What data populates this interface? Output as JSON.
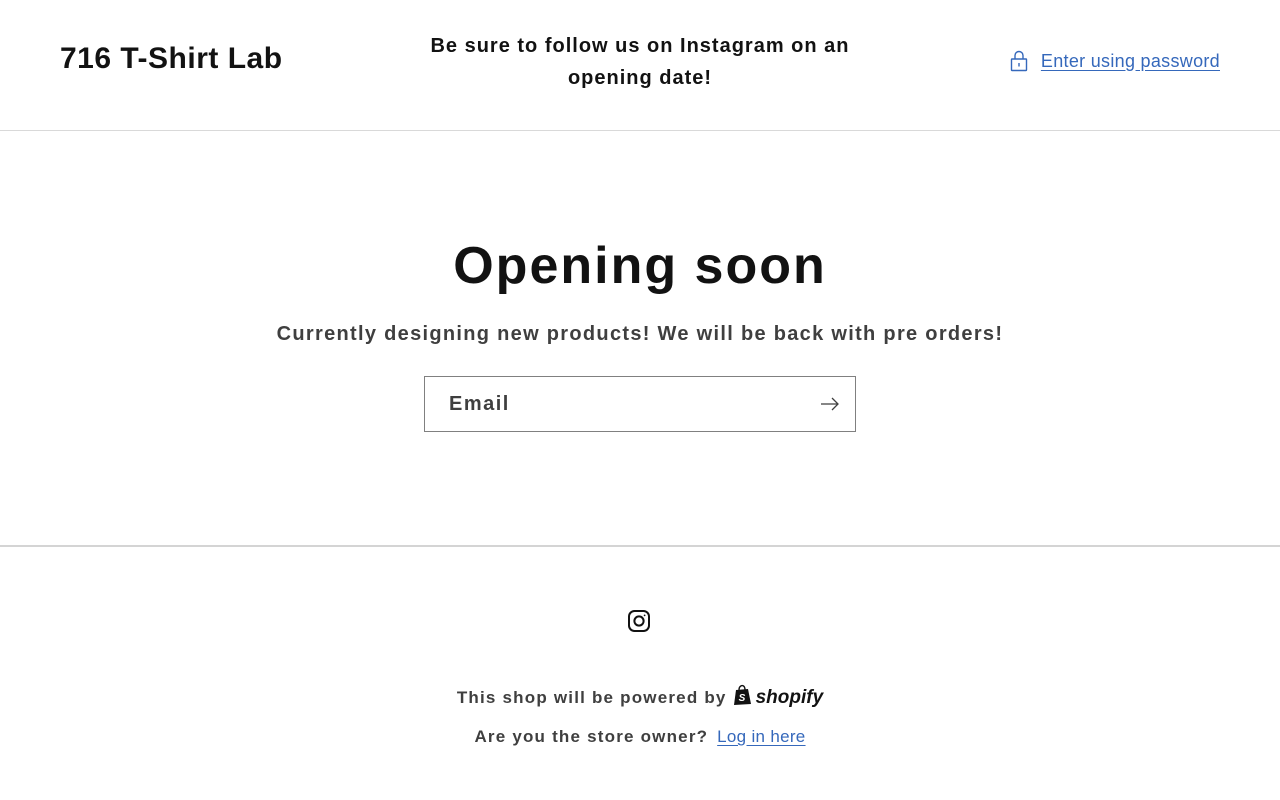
{
  "header": {
    "logo": "716 T-Shirt Lab",
    "announcement": "Be sure to follow us on Instagram on an opening date!",
    "password_link": "Enter using password",
    "password_icon": "lock-icon"
  },
  "hero": {
    "title": "Opening soon",
    "subtitle": "Currently designing new products! We will be back with pre orders!",
    "email_placeholder": "Email",
    "submit_icon": "arrow-right-icon"
  },
  "footer": {
    "social_icon": "instagram-icon",
    "powered_by": "This shop will be powered by",
    "shopify_wordmark": "shopify",
    "owner_question": "Are you the store owner?",
    "login_link": "Log in here"
  },
  "colors": {
    "text_primary": "#121212",
    "text_secondary": "#3f3f3f",
    "link": "#3568bb",
    "divider": "#d9d9d9"
  }
}
